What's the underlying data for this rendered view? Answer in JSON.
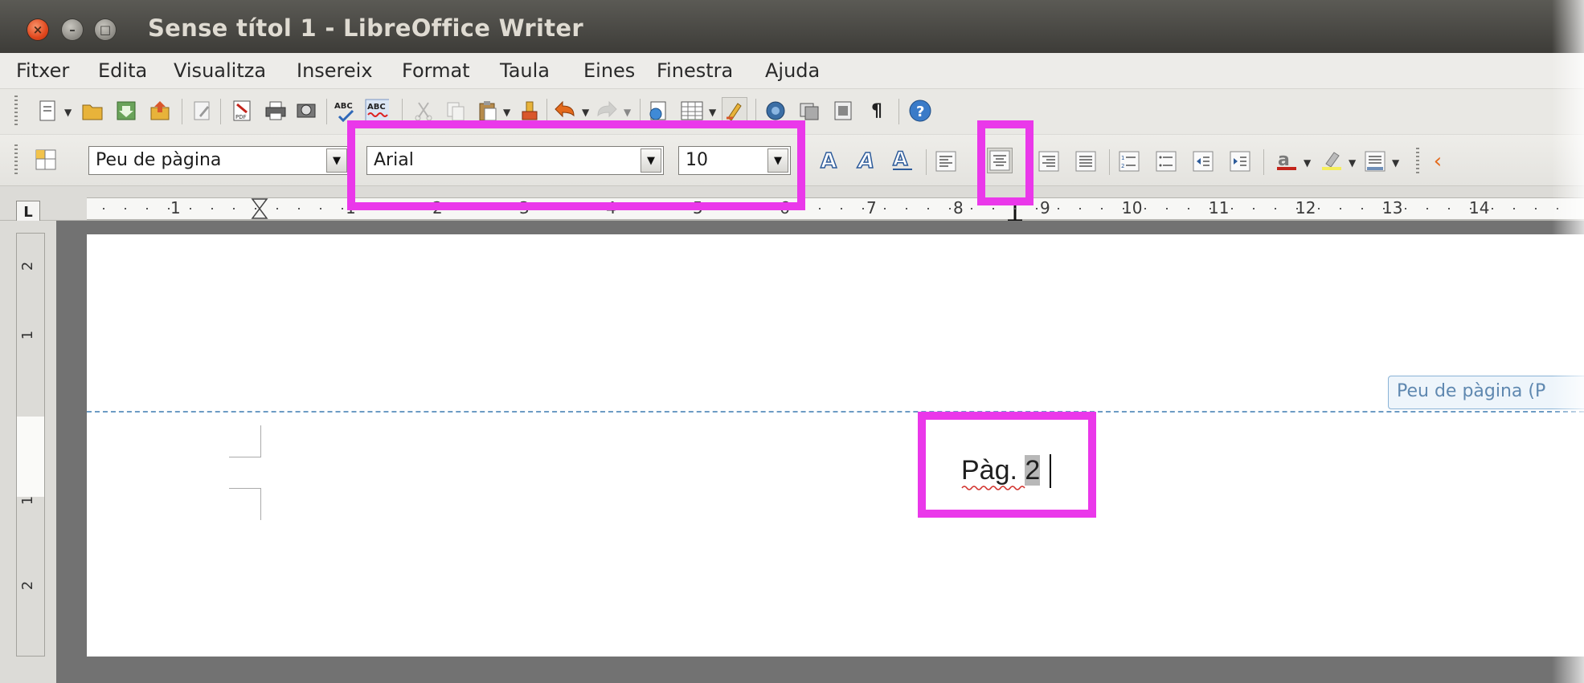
{
  "window": {
    "title": "Sense títol 1 - LibreOffice Writer",
    "controls": {
      "close": "×",
      "minimize": "–",
      "maximize": "□"
    }
  },
  "menu": [
    "Fitxer",
    "Edita",
    "Visualitza",
    "Insereix",
    "Format",
    "Taula",
    "Eines",
    "Finestra",
    "Ajuda"
  ],
  "formatting": {
    "paragraph_style": "Peu de pàgina",
    "font_name": "Arial",
    "font_size": "10",
    "alignment_selected": "center"
  },
  "ruler": {
    "numbers": [
      "1",
      "1",
      "2",
      "3",
      "4",
      "5",
      "6",
      "7",
      "8",
      "9",
      "10",
      "11",
      "12",
      "13",
      "14"
    ],
    "corner": "L"
  },
  "vertical_ruler": {
    "numbers": [
      "2",
      "1",
      "1",
      "2"
    ]
  },
  "document": {
    "footer_tag": "Peu de pàgina (P",
    "footer_text_prefix": "Pàg. ",
    "footer_page_number": "2"
  },
  "colors": {
    "highlight": "#ea38ea",
    "titlebar": "#3d3c38",
    "footer_dashed_line": "#6c9bc4"
  },
  "icons": {
    "new_document": "new-document-icon",
    "open": "open-folder-icon",
    "save": "save-icon",
    "export": "export-icon",
    "edit_file": "edit-file-icon",
    "export_pdf": "pdf-icon",
    "print": "print-icon",
    "print_preview": "print-preview-icon",
    "spellcheck": "spellcheck-icon",
    "autospellcheck": "autospellcheck-icon",
    "cut": "cut-icon",
    "copy": "copy-icon",
    "paste": "paste-icon",
    "clone_format": "clone-format-icon",
    "undo": "undo-icon",
    "redo": "redo-icon",
    "hyperlink": "hyperlink-icon",
    "table": "table-icon",
    "draw": "draw-functions-icon",
    "navigator": "navigator-icon",
    "gallery": "gallery-icon",
    "data_sources": "data-sources-icon",
    "formatting_marks": "formatting-marks-icon",
    "help": "help-icon"
  }
}
